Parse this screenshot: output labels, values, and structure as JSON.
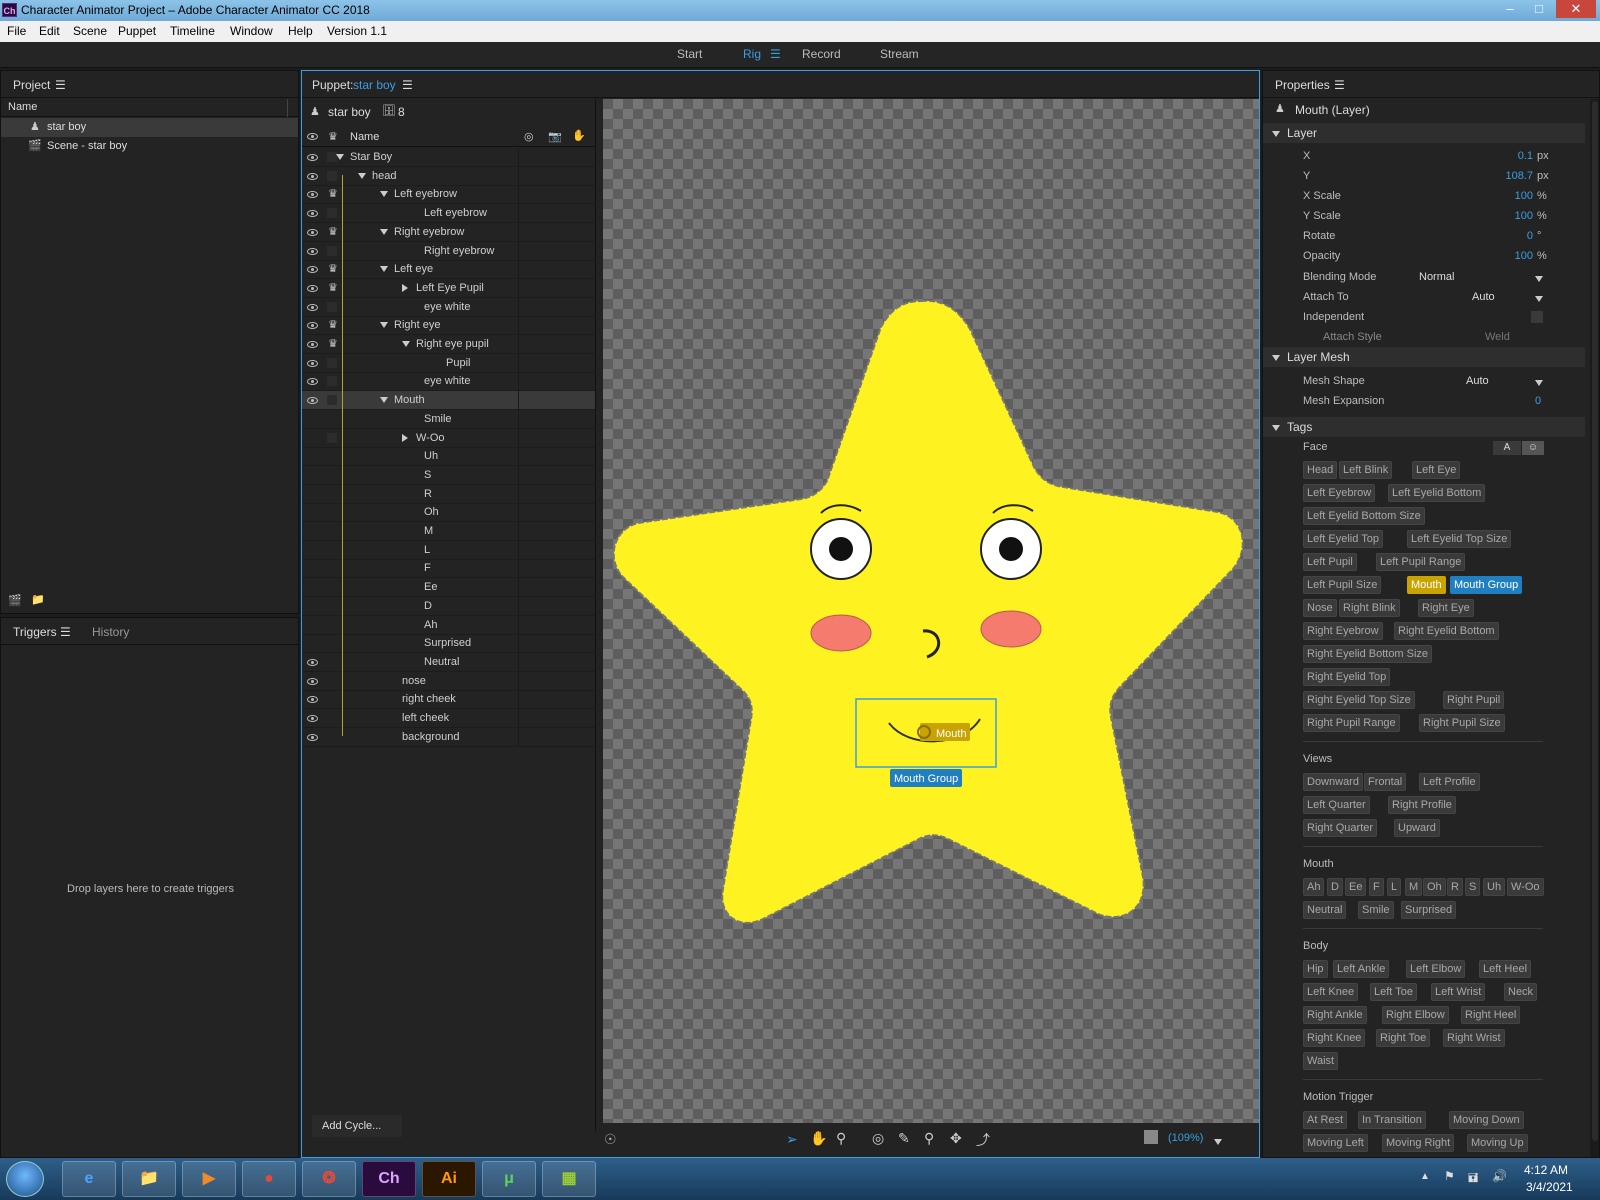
{
  "window": {
    "title": "Character Animator Project – Adobe Character Animator CC 2018",
    "app_badge": "Ch"
  },
  "menu": [
    "File",
    "Edit",
    "Scene",
    "Puppet",
    "Timeline",
    "Window",
    "Help",
    "Version 1.1"
  ],
  "workspace": {
    "tabs": [
      "Start",
      "Rig",
      "Record",
      "Stream"
    ],
    "active": "Rig"
  },
  "project": {
    "title": "Project",
    "name_header": "Name",
    "items": [
      "star boy",
      "Scene - star boy"
    ]
  },
  "triggers": {
    "tab1": "Triggers",
    "tab2": "History",
    "empty_text": "Drop layers here to create triggers"
  },
  "puppet": {
    "title_prefix": "Puppet:",
    "title_name": "star boy",
    "name": "star boy",
    "count": "8",
    "name_header": "Name",
    "add_cycle": "Add Cycle...",
    "zoom": "(109%)",
    "layers": [
      {
        "label": "Star Boy",
        "indent": 0,
        "exp": "down",
        "eye": true,
        "crown": false
      },
      {
        "label": "head",
        "indent": 1,
        "exp": "down",
        "eye": true,
        "crown": false
      },
      {
        "label": "Left eyebrow",
        "indent": 2,
        "exp": "down",
        "eye": true,
        "crown": true
      },
      {
        "label": "Left eyebrow",
        "indent": 3,
        "exp": "",
        "eye": true,
        "crown": false
      },
      {
        "label": "Right eyebrow",
        "indent": 2,
        "exp": "down",
        "eye": true,
        "crown": true
      },
      {
        "label": "Right eyebrow",
        "indent": 3,
        "exp": "",
        "eye": true,
        "crown": false
      },
      {
        "label": "Left eye",
        "indent": 2,
        "exp": "down",
        "eye": true,
        "crown": true
      },
      {
        "label": "Left Eye Pupil",
        "indent": 3,
        "exp": "right",
        "eye": true,
        "crown": true
      },
      {
        "label": "eye white",
        "indent": 3,
        "exp": "",
        "eye": true,
        "crown": false
      },
      {
        "label": "Right eye",
        "indent": 2,
        "exp": "down",
        "eye": true,
        "crown": true
      },
      {
        "label": "Right eye pupil",
        "indent": 3,
        "exp": "down",
        "eye": true,
        "crown": true
      },
      {
        "label": "Pupil",
        "indent": 4,
        "exp": "",
        "eye": true,
        "crown": false
      },
      {
        "label": "eye white",
        "indent": 3,
        "exp": "",
        "eye": true,
        "crown": false
      },
      {
        "label": "Mouth",
        "indent": 2,
        "exp": "down",
        "eye": true,
        "crown": false,
        "selected": true
      },
      {
        "label": "Smile",
        "indent": 3,
        "exp": "",
        "eye": false,
        "crown": false
      },
      {
        "label": "W-Oo",
        "indent": 3,
        "exp": "right",
        "eye": false,
        "crown": false
      },
      {
        "label": "Uh",
        "indent": 3,
        "exp": "",
        "eye": false,
        "crown": false
      },
      {
        "label": "S",
        "indent": 3,
        "exp": "",
        "eye": false,
        "crown": false
      },
      {
        "label": "R",
        "indent": 3,
        "exp": "",
        "eye": false,
        "crown": false
      },
      {
        "label": "Oh",
        "indent": 3,
        "exp": "",
        "eye": false,
        "crown": false
      },
      {
        "label": "M",
        "indent": 3,
        "exp": "",
        "eye": false,
        "crown": false
      },
      {
        "label": "L",
        "indent": 3,
        "exp": "",
        "eye": false,
        "crown": false
      },
      {
        "label": "F",
        "indent": 3,
        "exp": "",
        "eye": false,
        "crown": false
      },
      {
        "label": "Ee",
        "indent": 3,
        "exp": "",
        "eye": false,
        "crown": false
      },
      {
        "label": "D",
        "indent": 3,
        "exp": "",
        "eye": false,
        "crown": false
      },
      {
        "label": "Ah",
        "indent": 3,
        "exp": "",
        "eye": false,
        "crown": false
      },
      {
        "label": "Surprised",
        "indent": 3,
        "exp": "",
        "eye": false,
        "crown": false
      },
      {
        "label": "Neutral",
        "indent": 3,
        "exp": "",
        "eye": true,
        "crown": false
      },
      {
        "label": "nose",
        "indent": 2,
        "exp": "",
        "eye": true,
        "crown": false
      },
      {
        "label": "right cheek",
        "indent": 2,
        "exp": "",
        "eye": true,
        "crown": false
      },
      {
        "label": "left cheek",
        "indent": 2,
        "exp": "",
        "eye": true,
        "crown": false
      },
      {
        "label": "background",
        "indent": 2,
        "exp": "",
        "eye": true,
        "crown": false
      }
    ],
    "canvas": {
      "mouth_handle": "Mouth",
      "mouth_group": "Mouth Group"
    }
  },
  "properties": {
    "title": "Properties",
    "layer_title": "Mouth (Layer)",
    "section_layer": "Layer",
    "rows": [
      {
        "label": "X",
        "value": "0.1",
        "unit": "px"
      },
      {
        "label": "Y",
        "value": "108.7",
        "unit": "px"
      },
      {
        "label": "X Scale",
        "value": "100",
        "unit": "%"
      },
      {
        "label": "Y Scale",
        "value": "100",
        "unit": "%"
      },
      {
        "label": "Rotate",
        "value": "0",
        "unit": "°"
      },
      {
        "label": "Opacity",
        "value": "100",
        "unit": "%"
      }
    ],
    "blending_label": "Blending Mode",
    "blending_value": "Normal",
    "attach_label": "Attach To",
    "attach_value": "Auto",
    "independent_label": "Independent",
    "attach_style_label": "Attach Style",
    "attach_style_value": "Weld",
    "section_mesh": "Layer Mesh",
    "mesh_shape_label": "Mesh Shape",
    "mesh_shape_value": "Auto",
    "mesh_exp_label": "Mesh Expansion",
    "mesh_exp_value": "0",
    "section_tags": "Tags",
    "face_label": "Face",
    "face_btn": "A",
    "face_tags": [
      "Head",
      "Left Blink",
      "Left Eye",
      "Left Eyebrow",
      "Left Eyelid Bottom",
      "Left Eyelid Bottom Size",
      "Left Eyelid Top",
      "Left Eyelid Top Size",
      "Left Pupil",
      "Left Pupil Range",
      "Left Pupil Size",
      "Mouth",
      "Mouth Group",
      "Nose",
      "Right Blink",
      "Right Eye",
      "Right Eyebrow",
      "Right Eyelid Bottom",
      "Right Eyelid Bottom Size",
      "Right Eyelid Top",
      "Right Eyelid Top Size",
      "Right Pupil",
      "Right Pupil Range",
      "Right Pupil Size"
    ],
    "views_label": "Views",
    "views_tags": [
      "Downward",
      "Frontal",
      "Left Profile",
      "Left Quarter",
      "Right Profile",
      "Right Quarter",
      "Upward"
    ],
    "mouth_label": "Mouth",
    "mouth_tags": [
      "Ah",
      "D",
      "Ee",
      "F",
      "L",
      "M",
      "Oh",
      "R",
      "S",
      "Uh",
      "W-Oo",
      "Neutral",
      "Smile",
      "Surprised"
    ],
    "body_label": "Body",
    "body_tags": [
      "Hip",
      "Left Ankle",
      "Left Elbow",
      "Left Heel",
      "Left Knee",
      "Left Toe",
      "Left Wrist",
      "Neck",
      "Right Ankle",
      "Right Elbow",
      "Right Heel",
      "Right Knee",
      "Right Toe",
      "Right Wrist",
      "Waist"
    ],
    "motion_label": "Motion Trigger",
    "motion_tags": [
      "At Rest",
      "In Transition",
      "Moving Down",
      "Moving Left",
      "Moving Right",
      "Moving Up"
    ]
  },
  "taskbar": {
    "time": "4:12 AM",
    "date": "3/4/2021",
    "apps": [
      "",
      "",
      "",
      "",
      "",
      "",
      "Ch",
      "Ai",
      "",
      ""
    ]
  },
  "colors": {
    "accent": "#3b9ee0",
    "tag_yellow": "#c9a300",
    "tag_blue": "#1f7fc0",
    "star": "#fff221"
  }
}
